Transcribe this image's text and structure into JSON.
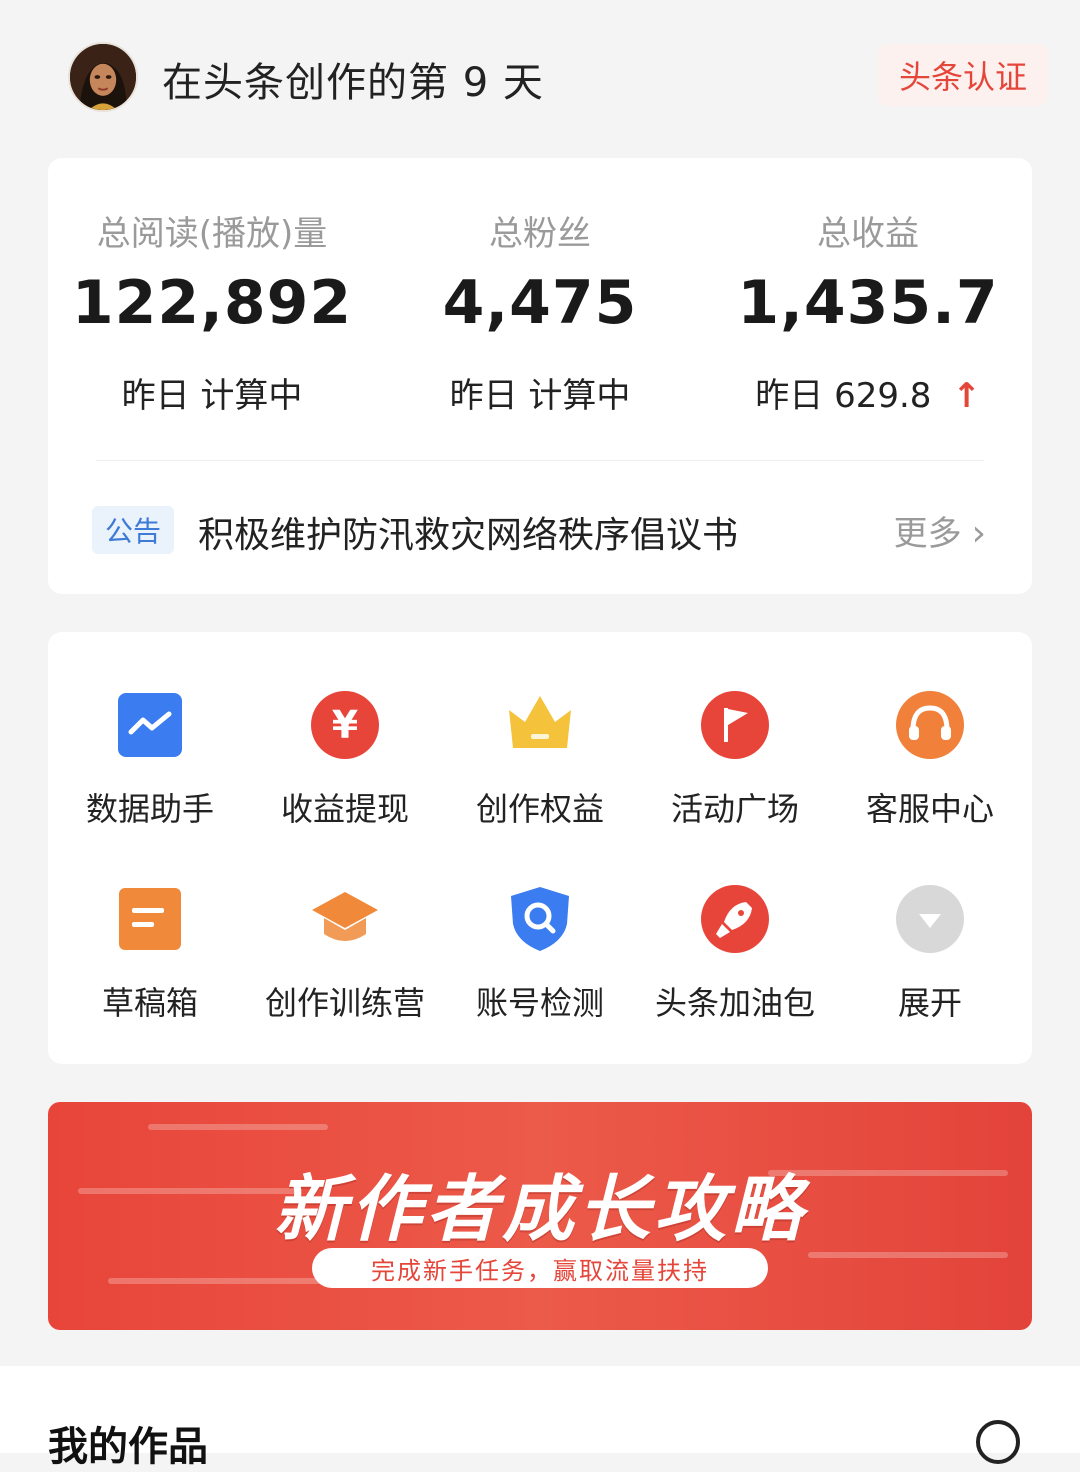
{
  "header": {
    "title": "在头条创作的第 9 天",
    "verify_label": "头条认证"
  },
  "stats": [
    {
      "label": "总阅读(播放)量",
      "value": "122,892",
      "sub_prefix": "昨日",
      "sub_value": "计算中"
    },
    {
      "label": "总粉丝",
      "value": "4,475",
      "sub_prefix": "昨日",
      "sub_value": "计算中"
    },
    {
      "label": "总收益",
      "value": "1,435.7",
      "sub_prefix": "昨日",
      "sub_value": "629.8",
      "trend_icon": "arrow-up"
    }
  ],
  "notice": {
    "tag": "公告",
    "text": "积极维护防汛救灾网络秩序倡议书",
    "more": "更多",
    "more_icon": "chevron-right"
  },
  "grid": [
    {
      "label": "数据助手",
      "icon": "chart-icon",
      "color": "#3b7cf0"
    },
    {
      "label": "收益提现",
      "icon": "yuan-icon",
      "color": "#e8453a"
    },
    {
      "label": "创作权益",
      "icon": "crown-icon",
      "color": "#f5c33b"
    },
    {
      "label": "活动广场",
      "icon": "flag-icon",
      "color": "#e8453a"
    },
    {
      "label": "客服中心",
      "icon": "headset-icon",
      "color": "#f0803a"
    },
    {
      "label": "草稿箱",
      "icon": "draft-icon",
      "color": "#f08a3a"
    },
    {
      "label": "创作训练营",
      "icon": "graduation-cap-icon",
      "color": "#f08a3a"
    },
    {
      "label": "账号检测",
      "icon": "shield-search-icon",
      "color": "#3b7cf0"
    },
    {
      "label": "头条加油包",
      "icon": "rocket-icon",
      "color": "#e8453a"
    },
    {
      "label": "展开",
      "icon": "expand-icon",
      "color": "#d0d0d0"
    }
  ],
  "banner": {
    "title": "新作者成长攻略",
    "subtitle": "完成新手任务，赢取流量扶持"
  },
  "works": {
    "title": "我的作品"
  }
}
